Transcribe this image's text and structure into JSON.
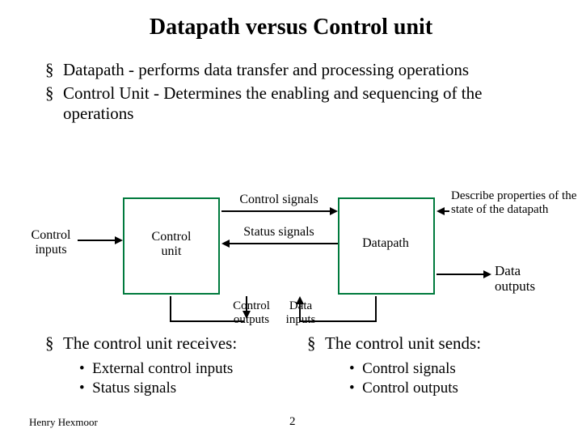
{
  "title": "Datapath versus Control unit",
  "top_bullets": [
    "Datapath - performs data transfer and processing operations",
    "Control Unit - Determines the enabling and sequencing of the operations"
  ],
  "diagram": {
    "control_inputs": "Control inputs",
    "control_unit": "Control unit",
    "control_signals": "Control signals",
    "status_signals": "Status signals",
    "datapath": "Datapath",
    "describe": "Describe properties of the state of the datapath",
    "data_outputs": "Data outputs",
    "control_outputs": "Control outputs",
    "data_inputs": "Data inputs"
  },
  "receives": {
    "heading": "The control unit receives:",
    "items": [
      "External control inputs",
      "Status signals"
    ]
  },
  "sends": {
    "heading": "The control unit sends:",
    "items": [
      "Control signals",
      "Control outputs"
    ]
  },
  "footer": {
    "author": "Henry Hexmoor",
    "page": "2"
  }
}
